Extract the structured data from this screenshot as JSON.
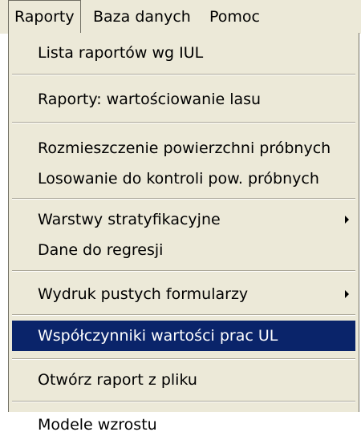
{
  "menubar": {
    "items": [
      {
        "label": "Raporty",
        "state": "open"
      },
      {
        "label": "Baza danych"
      },
      {
        "label": "Pomoc"
      }
    ]
  },
  "dropdown": {
    "items": [
      {
        "label": "Lista raportów wg IUL"
      },
      {
        "label": "Raporty: wartościowanie lasu"
      },
      {
        "label": "Rozmieszczenie powierzchni próbnych"
      },
      {
        "label": "Losowanie do kontroli pow. próbnych"
      },
      {
        "label": "Warstwy stratyfikacyjne",
        "submenu_icon": "submenu-arrow-icon"
      },
      {
        "label": "Dane do regresji"
      },
      {
        "label": "Wydruk pustych formularzy",
        "submenu_icon": "submenu-arrow-icon"
      },
      {
        "label": "Współczynniki wartości prac UL",
        "state": "highlighted"
      },
      {
        "label": "Otwórz raport z pliku"
      },
      {
        "label": "Modele wzrostu"
      }
    ]
  },
  "colors": {
    "menu_background": "#ece9d8",
    "highlight_background": "#0a246a",
    "highlight_text": "#ffffff",
    "separator_dark": "#aca899",
    "border": "#716f64"
  }
}
